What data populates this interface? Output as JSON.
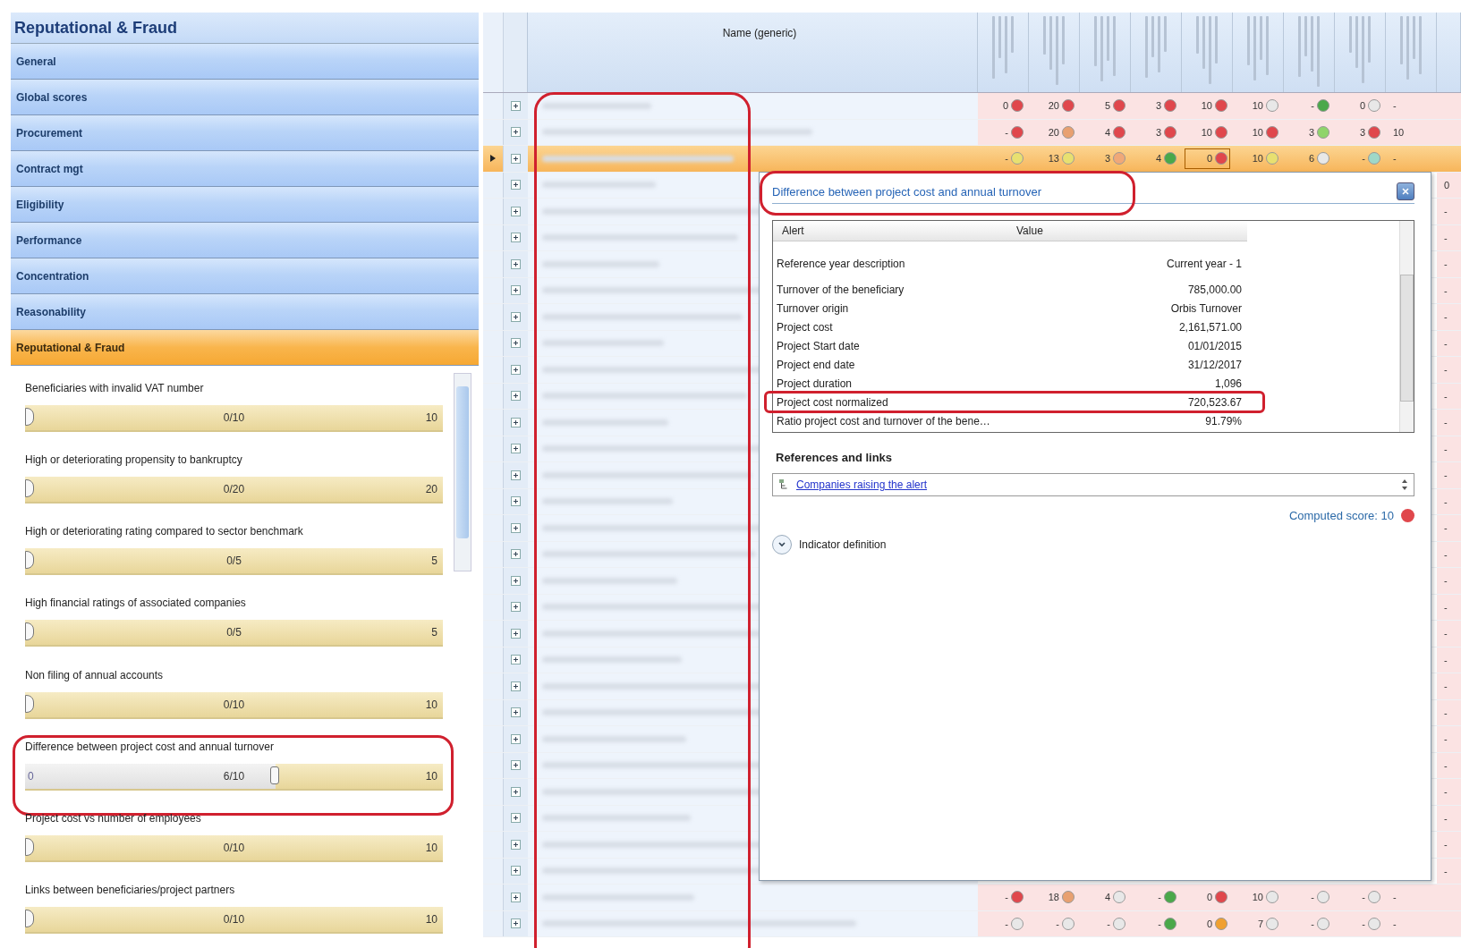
{
  "left_panel": {
    "title": "Reputational & Fraud",
    "nav": [
      {
        "label": "General",
        "selected": false
      },
      {
        "label": "Global scores",
        "selected": false
      },
      {
        "label": "Procurement",
        "selected": false
      },
      {
        "label": "Contract mgt",
        "selected": false
      },
      {
        "label": "Eligibility",
        "selected": false
      },
      {
        "label": "Performance",
        "selected": false
      },
      {
        "label": "Concentration",
        "selected": false
      },
      {
        "label": "Reasonability",
        "selected": false
      },
      {
        "label": "Reputational & Fraud",
        "selected": true
      }
    ],
    "sliders": [
      {
        "label": "Beneficiaries with invalid VAT number",
        "value": "0/10",
        "max": "10",
        "level": 0,
        "highlighted": false
      },
      {
        "label": "High or deteriorating propensity to bankruptcy",
        "value": "0/20",
        "max": "20",
        "level": 0,
        "highlighted": false
      },
      {
        "label": "High or deteriorating rating compared to sector benchmark",
        "value": "0/5",
        "max": "5",
        "level": 0,
        "highlighted": false
      },
      {
        "label": "High financial ratings of associated companies",
        "value": "0/5",
        "max": "5",
        "level": 0,
        "highlighted": false
      },
      {
        "label": "Non filing of annual accounts",
        "value": "0/10",
        "max": "10",
        "level": 0,
        "highlighted": false
      },
      {
        "label": "Difference between project cost and annual turnover",
        "min": "0",
        "value": "6/10",
        "max": "10",
        "level": 0.6,
        "highlighted": true
      },
      {
        "label": "Project cost vs number of employees",
        "value": "0/10",
        "max": "10",
        "level": 0,
        "highlighted": false
      },
      {
        "label": "Links between beneficiaries/project partners",
        "value": "0/10",
        "max": "10",
        "level": 0,
        "highlighted": false
      }
    ]
  },
  "grid": {
    "name_header": "Name (generic)",
    "name_column_highlighted": true,
    "rows": [
      {
        "selected": false,
        "cells": [
          {
            "text": "0",
            "color": "#e0474c"
          },
          {
            "text": "20",
            "color": "#e0474c"
          },
          {
            "text": "5",
            "color": "#e0474c"
          },
          {
            "text": "3",
            "color": "#e0474c"
          },
          {
            "text": "10",
            "color": "#e0474c"
          },
          {
            "text": "10",
            "color": "#e8e8e8"
          },
          {
            "text": "-",
            "color": "#4aa84a"
          },
          {
            "text": "0",
            "color": "#e8e8e8"
          }
        ],
        "edge": "-"
      },
      {
        "selected": false,
        "cells": [
          {
            "text": "-",
            "color": "#e0474c"
          },
          {
            "text": "20",
            "color": "#e8a070"
          },
          {
            "text": "4",
            "color": "#e0474c"
          },
          {
            "text": "3",
            "color": "#e0474c"
          },
          {
            "text": "10",
            "color": "#e0474c"
          },
          {
            "text": "10",
            "color": "#e0474c"
          },
          {
            "text": "3",
            "color": "#8fd46a"
          },
          {
            "text": "3",
            "color": "#e0474c"
          }
        ],
        "edge": "10"
      },
      {
        "selected": true,
        "cells": [
          {
            "text": "-",
            "color": "#e8e070"
          },
          {
            "text": "13",
            "color": "#e8e070"
          },
          {
            "text": "3",
            "color": "#f0a878"
          },
          {
            "text": "4",
            "color": "#4aa84a"
          },
          {
            "text": "0",
            "color": "#e0474c",
            "focused": true
          },
          {
            "text": "10",
            "color": "#e8e070"
          },
          {
            "text": "6",
            "color": "#e8e8e8"
          },
          {
            "text": "-",
            "color": "#9fd8c8"
          }
        ],
        "edge": "-"
      },
      {
        "selected": false,
        "edge": "0"
      },
      {
        "selected": false,
        "edge": "-"
      },
      {
        "selected": false,
        "edge": "-"
      },
      {
        "selected": false,
        "edge": "-"
      },
      {
        "selected": false,
        "edge": "-"
      },
      {
        "selected": false,
        "edge": "-"
      },
      {
        "selected": false,
        "edge": "-"
      },
      {
        "selected": false,
        "edge": "-"
      },
      {
        "selected": false,
        "edge": "-"
      },
      {
        "selected": false,
        "edge": "-"
      },
      {
        "selected": false,
        "edge": "-"
      },
      {
        "selected": false,
        "edge": "-"
      },
      {
        "selected": false,
        "edge": "-"
      },
      {
        "selected": false,
        "edge": "-"
      },
      {
        "selected": false,
        "edge": "-"
      },
      {
        "selected": false,
        "edge": "-"
      },
      {
        "selected": false,
        "edge": "-"
      },
      {
        "selected": false,
        "edge": "-"
      },
      {
        "selected": false,
        "edge": "-"
      },
      {
        "selected": false,
        "edge": "-"
      },
      {
        "selected": false,
        "edge": "-"
      },
      {
        "selected": false,
        "edge": "-"
      },
      {
        "selected": false,
        "edge": "-"
      },
      {
        "selected": false,
        "edge": "-"
      },
      {
        "selected": false,
        "edge": "-"
      },
      {
        "selected": false,
        "edge": "-"
      },
      {
        "selected": false,
        "edge": "-"
      },
      {
        "selected": false,
        "cells": [
          {
            "text": "-",
            "color": "#e0474c"
          },
          {
            "text": "18",
            "color": "#e8a070"
          },
          {
            "text": "4",
            "color": "#e8e8e8"
          },
          {
            "text": "-",
            "color": "#4aa84a"
          },
          {
            "text": "0",
            "color": "#e0474c"
          },
          {
            "text": "10",
            "color": "#e8e8e8"
          },
          {
            "text": "-",
            "color": "#e8e8e8"
          },
          {
            "text": "-",
            "color": "#e8e8e8"
          }
        ],
        "edge": "-"
      },
      {
        "selected": false,
        "cells": [
          {
            "text": "-",
            "color": "#e8e8e8"
          },
          {
            "text": "-",
            "color": "#e8e8e8"
          },
          {
            "text": "-",
            "color": "#e8e8e8"
          },
          {
            "text": "-",
            "color": "#4aa84a"
          },
          {
            "text": "0",
            "color": "#f0a030"
          },
          {
            "text": "7",
            "color": "#e8e8e8"
          },
          {
            "text": "-",
            "color": "#e8e8e8"
          },
          {
            "text": "-",
            "color": "#e8e8e8"
          }
        ],
        "edge": "-"
      }
    ]
  },
  "popup": {
    "title": "Difference between project cost and annual turnover",
    "title_highlighted": true,
    "columns": [
      "Alert",
      "Value"
    ],
    "rows": [
      {
        "label": "Reference year description",
        "value": "Current year - 1",
        "highlighted": false
      },
      {
        "label": "Turnover of the beneficiary",
        "value": "785,000.00",
        "highlighted": false
      },
      {
        "label": "Turnover origin",
        "value": "Orbis Turnover",
        "highlighted": false
      },
      {
        "label": "Project cost",
        "value": "2,161,571.00",
        "highlighted": false
      },
      {
        "label": "Project Start date",
        "value": "01/01/2015",
        "highlighted": false
      },
      {
        "label": "Project end date",
        "value": "31/12/2017",
        "highlighted": false
      },
      {
        "label": "Project duration",
        "value": "1,096",
        "highlighted": false
      },
      {
        "label": "Project cost normalized",
        "value": "720,523.67",
        "highlighted": true
      },
      {
        "label": "Ratio project cost and turnover of the bene…",
        "value": "91.79%",
        "highlighted": false
      }
    ],
    "references_heading": "References and links",
    "link": "Companies raising the alert",
    "score": "Computed score: 10",
    "score_dot": {
      "color": "#e0474c"
    },
    "definition": "Indicator definition"
  }
}
